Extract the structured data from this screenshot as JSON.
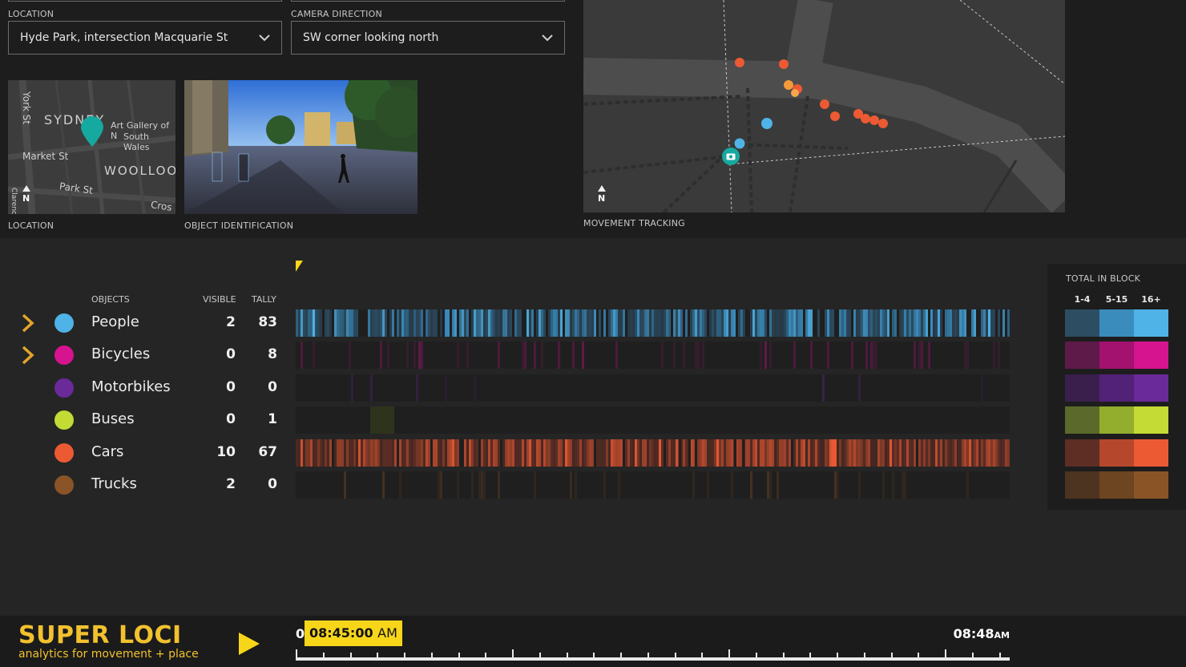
{
  "filters": {
    "location": {
      "label": "LOCATION",
      "value": "Hyde Park, intersection Macquarie St"
    },
    "camera_direction": {
      "label": "CAMERA DIRECTION",
      "value": "SW corner looking north"
    }
  },
  "location_map": {
    "caption": "LOCATION",
    "labels": [
      "SYDNEY",
      "Art Gallery of N",
      "South Wales",
      "York St",
      "Market St",
      "WOOLLOO",
      "Park St",
      "Cros",
      "Clarence",
      "N"
    ]
  },
  "object_identification": {
    "caption": "OBJECT IDENTIFICATION"
  },
  "movement_tracking": {
    "caption": "MOVEMENT TRACKING",
    "north": "N"
  },
  "objects": {
    "headers": {
      "objects": "OBJECTS",
      "visible": "VISIBLE",
      "tally": "TALLY"
    },
    "rows": [
      {
        "name": "People",
        "visible": "2",
        "tally": "83",
        "color": "#4fb3e8",
        "expandable": true
      },
      {
        "name": "Bicycles",
        "visible": "0",
        "tally": "8",
        "color": "#d6148f",
        "expandable": true
      },
      {
        "name": "Motorbikes",
        "visible": "0",
        "tally": "0",
        "color": "#6a2a9a",
        "expandable": false
      },
      {
        "name": "Buses",
        "visible": "0",
        "tally": "1",
        "color": "#c3db34",
        "expandable": false
      },
      {
        "name": "Cars",
        "visible": "10",
        "tally": "67",
        "color": "#ec5a34",
        "expandable": false
      },
      {
        "name": "Trucks",
        "visible": "2",
        "tally": "0",
        "color": "#8a5426",
        "expandable": false
      }
    ]
  },
  "legend": {
    "title": "TOTAL IN BLOCK",
    "columns": [
      "1-4",
      "5-15",
      "16+"
    ],
    "swatches": [
      [
        "#2d4d63",
        "#3a8cbd",
        "#4fb3e8"
      ],
      [
        "#5e1a49",
        "#a3126f",
        "#d6148f"
      ],
      [
        "#3a1f4d",
        "#522178",
        "#6a2a9a"
      ],
      [
        "#5b6a2a",
        "#93ad2d",
        "#c3db34"
      ],
      [
        "#5e2e25",
        "#b5482c",
        "#ec5a34"
      ],
      [
        "#4d3420",
        "#6d4521",
        "#8a5426"
      ]
    ]
  },
  "brand": {
    "title": "SUPER LOCI",
    "subtitle": "analytics for movement + place"
  },
  "timeline": {
    "current_time": "08:45:00",
    "current_ampm": "AM",
    "end_time": "08:48",
    "end_ampm": "AM",
    "start_fragment": "0"
  }
}
